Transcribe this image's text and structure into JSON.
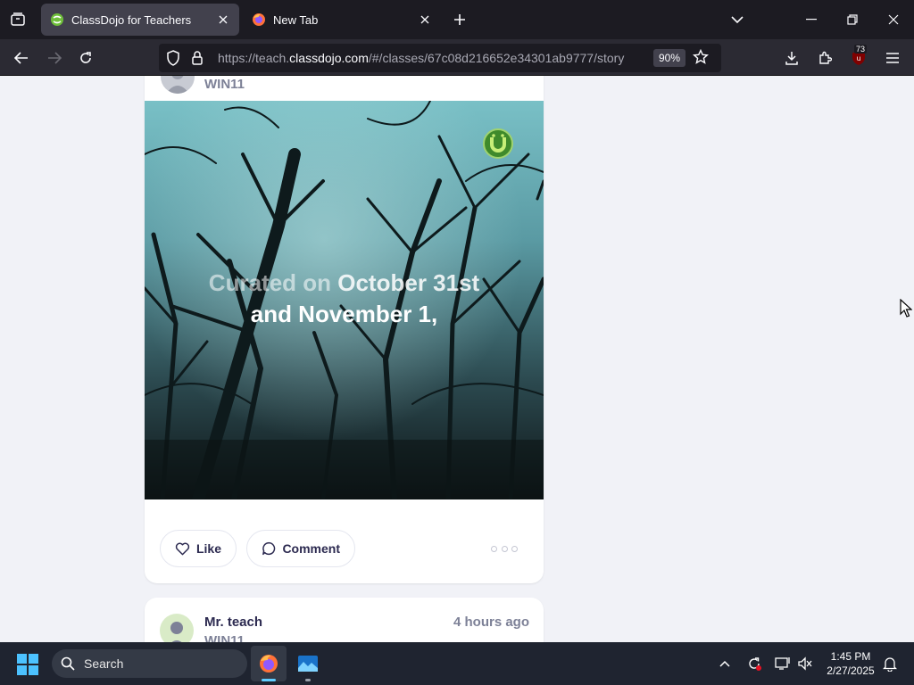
{
  "browser": {
    "tabs": [
      {
        "title": "ClassDojo for Teachers",
        "active": true,
        "favicon": "classdojo-icon"
      },
      {
        "title": "New Tab",
        "active": false,
        "favicon": "firefox-icon"
      }
    ],
    "url_prefix": "https://teach.",
    "url_domain": "classdojo.com",
    "url_suffix": "/#/classes/67c08d216652e34301ab9777/story",
    "zoom": "90%",
    "extension_badge": "73"
  },
  "feed": {
    "post1": {
      "class_name": "WIN11",
      "caption_line1_faded": "Curated on ",
      "caption_line1_bold": "October 31st",
      "caption_line2": "and November 1,",
      "like_label": "Like",
      "comment_label": "Comment"
    },
    "post2": {
      "author": "Mr. teach",
      "class_name": "WIN11",
      "timestamp": "4 hours ago"
    }
  },
  "taskbar": {
    "search_label": "Search",
    "time": "1:45 PM",
    "date": "2/27/2025"
  },
  "colors": {
    "browser_tabbar": "#1c1b22",
    "browser_navbar": "#2b2a33",
    "page_background": "#f1f2f7",
    "text_primary": "#2c2a50",
    "text_muted": "#7d8197",
    "dojo_green": "#6fbf3a",
    "taskbar": "#1f2430"
  }
}
